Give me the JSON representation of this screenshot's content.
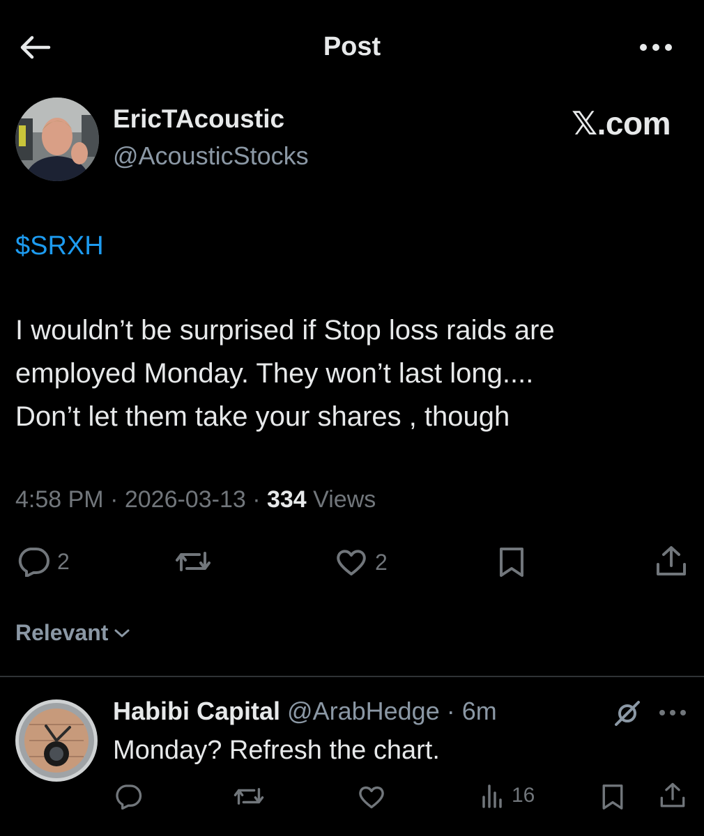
{
  "header": {
    "title": "Post"
  },
  "post": {
    "author": {
      "name": "EricTAcoustic",
      "handle": "@AcousticStocks"
    },
    "brand": "𝕏.com",
    "cashtag": "$SRXH",
    "text_lines": [
      "I wouldn’t be surprised if Stop loss raids are",
      "employed Monday. They won’t last long....",
      "Don’t let them take your shares , though"
    ],
    "time": "4:58 PM",
    "date": "2026-03-13",
    "views_count": "334",
    "views_label": "Views",
    "actions": {
      "replies": "2",
      "likes": "2"
    }
  },
  "sort": {
    "label": "Relevant"
  },
  "reply": {
    "name": "Habibi Capital",
    "handle": "@ArabHedge",
    "age": "6m",
    "text": "Monday? Refresh the chart.",
    "views": "16"
  },
  "icons": {
    "back": "arrow-left-icon",
    "more": "more-horizontal-icon",
    "reply": "speech-bubble-icon",
    "repost": "repost-icon",
    "like": "heart-icon",
    "bookmark": "bookmark-icon",
    "share": "share-icon",
    "analytics": "bar-chart-icon",
    "grok": "grok-icon"
  },
  "colors": {
    "background": "#000000",
    "text": "#e7e9ea",
    "muted": "#71767b",
    "link": "#1d9bf0"
  }
}
